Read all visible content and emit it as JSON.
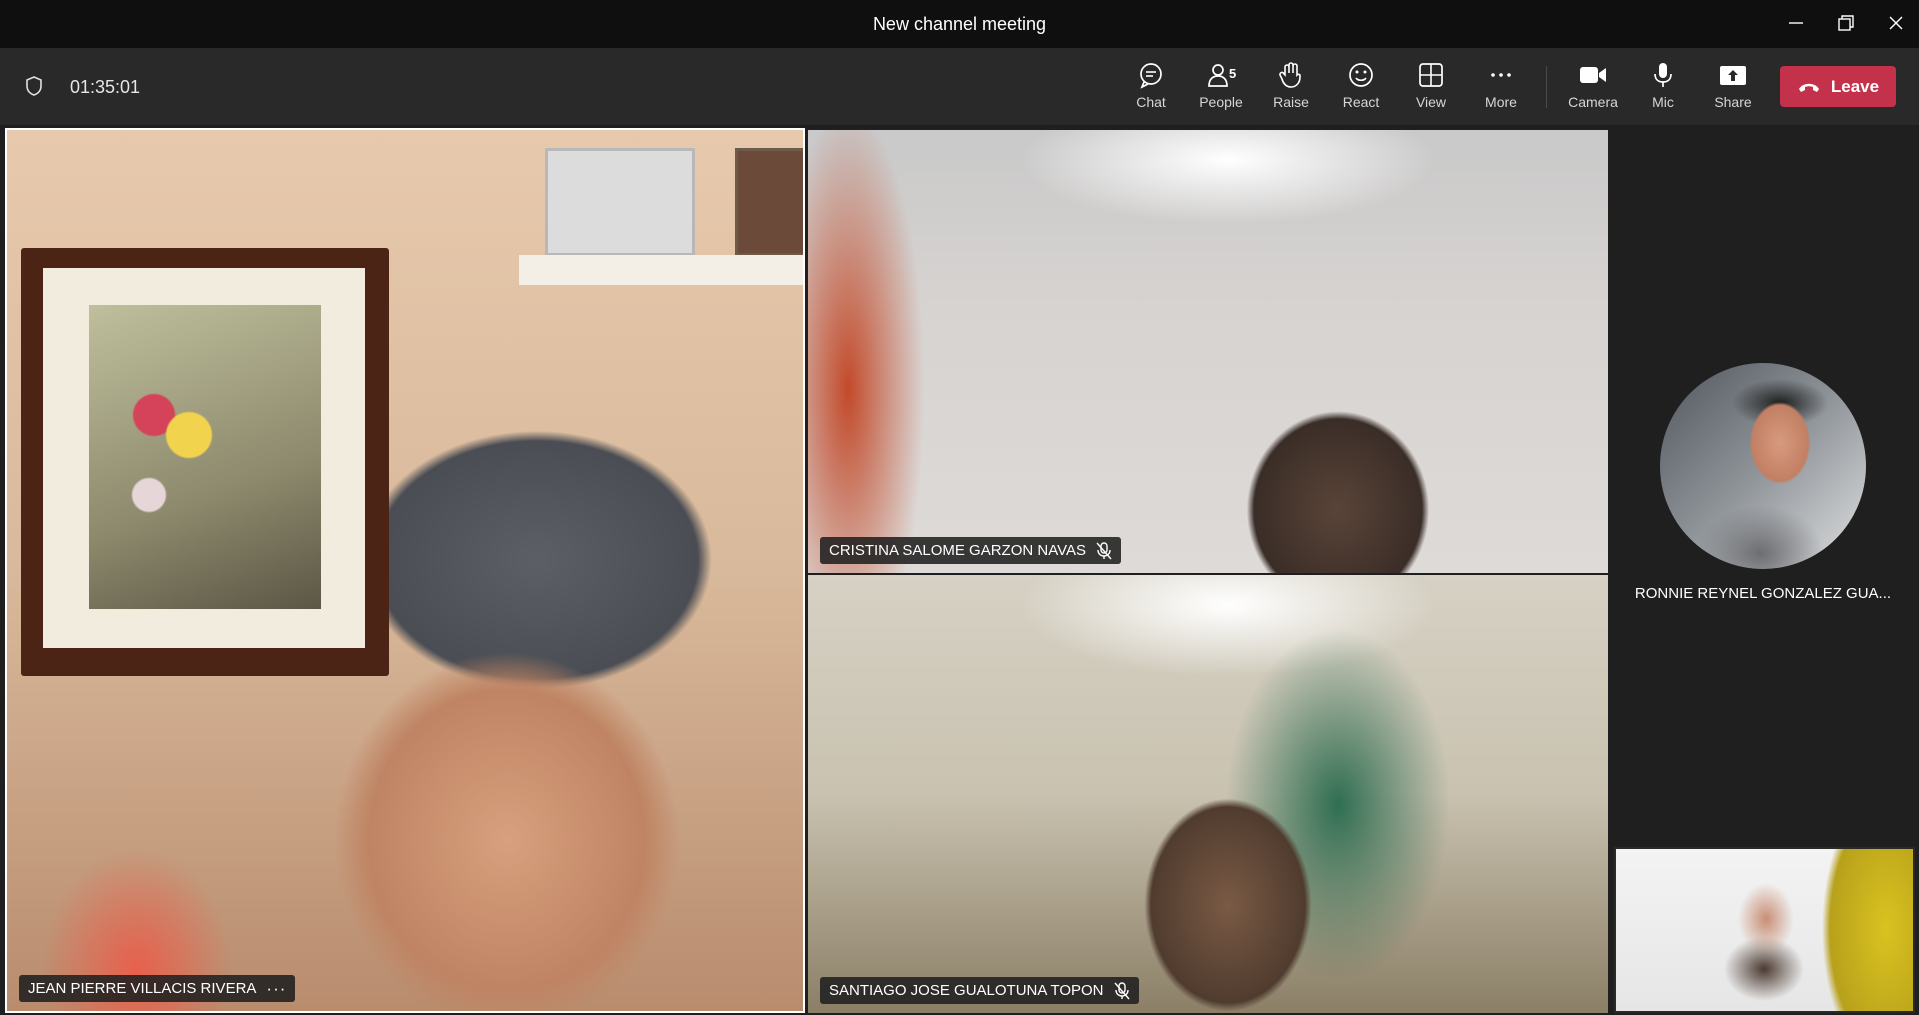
{
  "window": {
    "title": "New channel meeting"
  },
  "toolbar": {
    "timer": "01:35:01",
    "items": [
      {
        "label": "Chat",
        "icon": "chat-icon"
      },
      {
        "label": "People",
        "icon": "people-icon",
        "badge": "5"
      },
      {
        "label": "Raise",
        "icon": "raise-hand-icon"
      },
      {
        "label": "React",
        "icon": "react-icon"
      },
      {
        "label": "View",
        "icon": "view-icon"
      },
      {
        "label": "More",
        "icon": "more-icon"
      },
      {
        "label": "Camera",
        "icon": "camera-icon"
      },
      {
        "label": "Mic",
        "icon": "mic-icon"
      },
      {
        "label": "Share",
        "icon": "share-icon"
      }
    ],
    "leave_label": "Leave"
  },
  "participants": {
    "main": {
      "name": "JEAN PIERRE VILLACIS RIVERA"
    },
    "top_right": {
      "name": "CRISTINA SALOME GARZON NAVAS",
      "muted": true
    },
    "bottom_right": {
      "name": "SANTIAGO JOSE GUALOTUNA TOPON",
      "muted": true
    },
    "avatar": {
      "name": "RONNIE REYNEL GONZALEZ GUA..."
    }
  },
  "colors": {
    "leave": "#c4314b",
    "toolbar": "#292929",
    "titlebar": "#0f0f0f",
    "stage": "#1f1f1f"
  }
}
